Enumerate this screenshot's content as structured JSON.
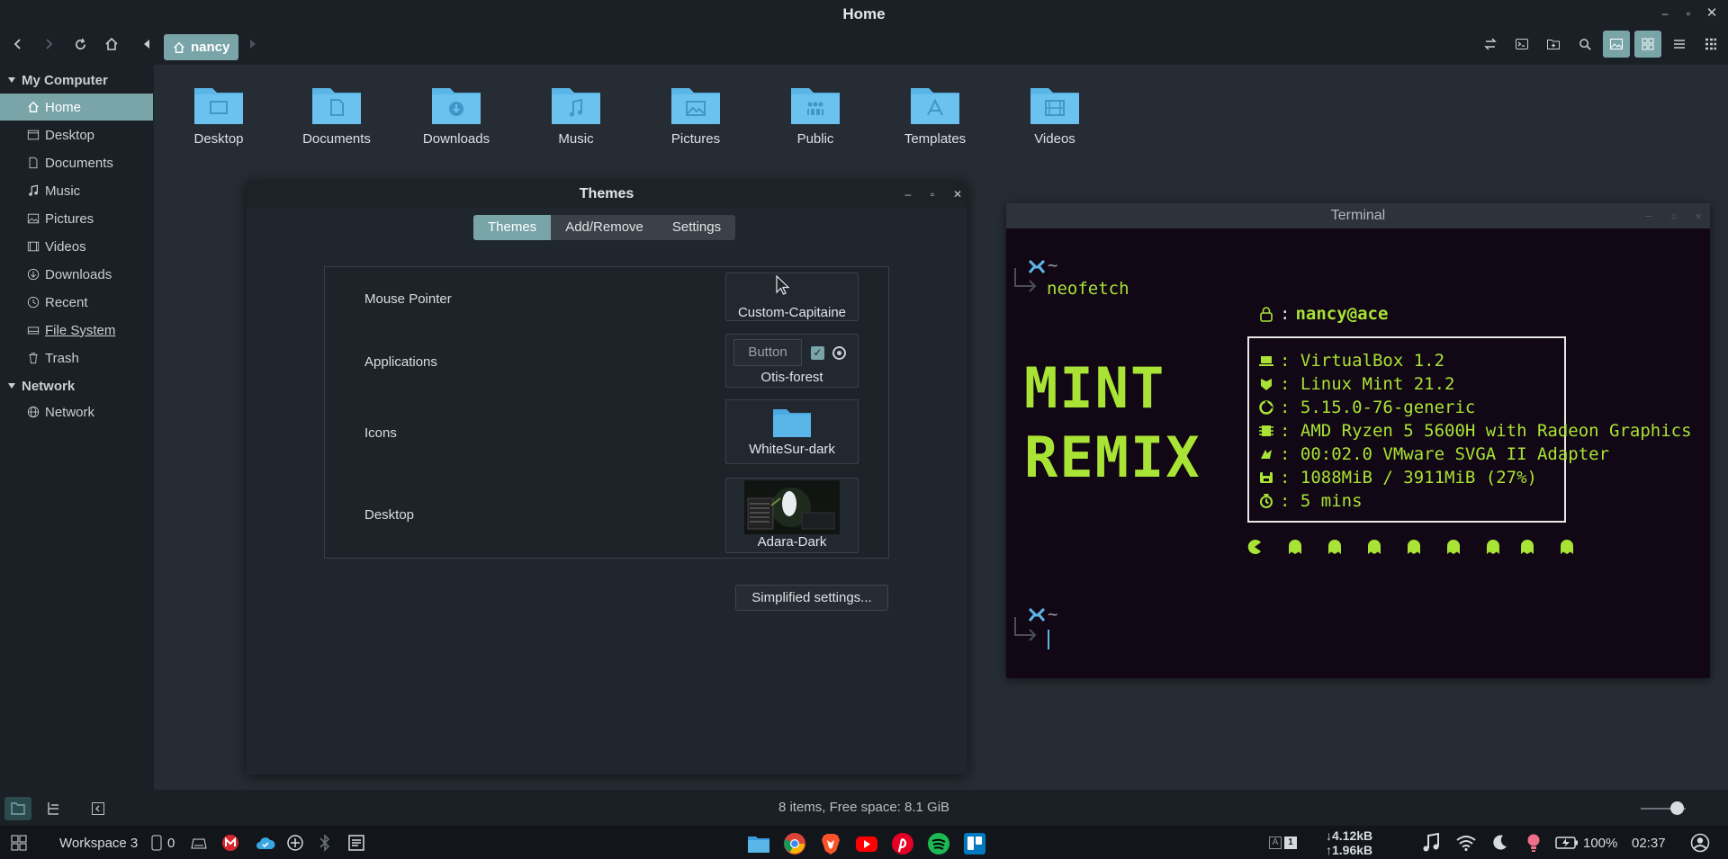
{
  "window": {
    "title": "Home"
  },
  "toolbar": {
    "location": "nancy"
  },
  "sidebar": {
    "sections": [
      {
        "title": "My Computer",
        "items": [
          "Home",
          "Desktop",
          "Documents",
          "Music",
          "Pictures",
          "Videos",
          "Downloads",
          "Recent",
          "File System",
          "Trash"
        ]
      },
      {
        "title": "Network",
        "items": [
          "Network"
        ]
      }
    ],
    "selected": "Home"
  },
  "folders": [
    "Desktop",
    "Documents",
    "Downloads",
    "Music",
    "Pictures",
    "Public",
    "Templates",
    "Videos"
  ],
  "themes_window": {
    "title": "Themes",
    "tabs": [
      "Themes",
      "Add/Remove",
      "Settings"
    ],
    "active_tab": "Themes",
    "rows": [
      {
        "label": "Mouse Pointer",
        "value": "Custom-Capitaine"
      },
      {
        "label": "Applications",
        "value": "Otis-forest",
        "preview_button": "Button"
      },
      {
        "label": "Icons",
        "value": "WhiteSur-dark"
      },
      {
        "label": "Desktop",
        "value": "Adara-Dark"
      }
    ],
    "simplified_button": "Simplified settings..."
  },
  "terminal": {
    "title": "Terminal",
    "prompt_symbol": "~",
    "command": "neofetch",
    "logo": [
      "MINT",
      "REMIX"
    ],
    "user": "nancy@ace",
    "info": [
      {
        "icon": "laptop-icon",
        "text": ": VirtualBox 1.2"
      },
      {
        "icon": "distro-icon",
        "text": ": Linux Mint 21.2"
      },
      {
        "icon": "kernel-icon",
        "text": ": 5.15.0-76-generic"
      },
      {
        "icon": "cpu-icon",
        "text": ": AMD Ryzen 5 5600H with Radeon Graphics"
      },
      {
        "icon": "gpu-icon",
        "text": ": 00:02.0 VMware SVGA II Adapter"
      },
      {
        "icon": "memory-icon",
        "text": ": 1088MiB / 3911MiB (27%)"
      },
      {
        "icon": "uptime-icon",
        "text": ": 5 mins"
      }
    ]
  },
  "statusbar": {
    "text": "8 items, Free space: 8.1 GiB",
    "zoom": 0.8
  },
  "panel": {
    "workspace": "Workspace 3",
    "notif_count": "0",
    "net_down": "4.12kB",
    "net_up": "1.96kB",
    "battery": "100%",
    "clock": "02:37",
    "keyboard_badge": "A",
    "keyboard_layout": "1"
  },
  "colors": {
    "accent": "#79a4a8",
    "folder": "#5bb6e8",
    "terminal_green": "#a8e335",
    "terminal_bg": "#120714"
  }
}
